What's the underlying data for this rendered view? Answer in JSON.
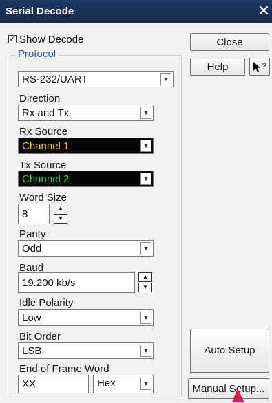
{
  "window": {
    "title": "Serial Decode",
    "close_glyph": "✕"
  },
  "show_decode": {
    "label": "Show Decode",
    "checked": true,
    "check_glyph": "☑"
  },
  "protocol": {
    "group_label": "Protocol",
    "value": "RS-232/UART"
  },
  "fields": {
    "direction": {
      "label": "Direction",
      "value": "Rx and Tx"
    },
    "rx_source": {
      "label": "Rx Source",
      "value": "Channel 1",
      "color": "#f2d21b"
    },
    "tx_source": {
      "label": "Tx Source",
      "value": "Channel 2",
      "color": "#45d24a"
    },
    "word_size": {
      "label": "Word Size",
      "value": "8"
    },
    "parity": {
      "label": "Parity",
      "value": "Odd"
    },
    "baud": {
      "label": "Baud",
      "value": "19.200 kb/s"
    },
    "idle_polarity": {
      "label": "Idle Polarity",
      "value": "Low"
    },
    "bit_order": {
      "label": "Bit Order",
      "value": "LSB"
    },
    "end_of_frame_word": {
      "label": "End of Frame Word",
      "value": "XX",
      "format": "Hex"
    }
  },
  "buttons": {
    "close": "Close",
    "help": "Help",
    "whats_this_glyph": "?",
    "auto_setup": "Auto Setup",
    "manual_setup": "Manual Setup..."
  },
  "icons": {
    "dropdown": "chevron-down-icon",
    "spin_up": "triangle-up-icon",
    "spin_down": "triangle-down-icon",
    "cursor": "arrow-pointer-icon"
  },
  "colors": {
    "titlebar": "#1d3a63",
    "group_label": "#2d4fb3",
    "pointer": "#e5174a"
  }
}
